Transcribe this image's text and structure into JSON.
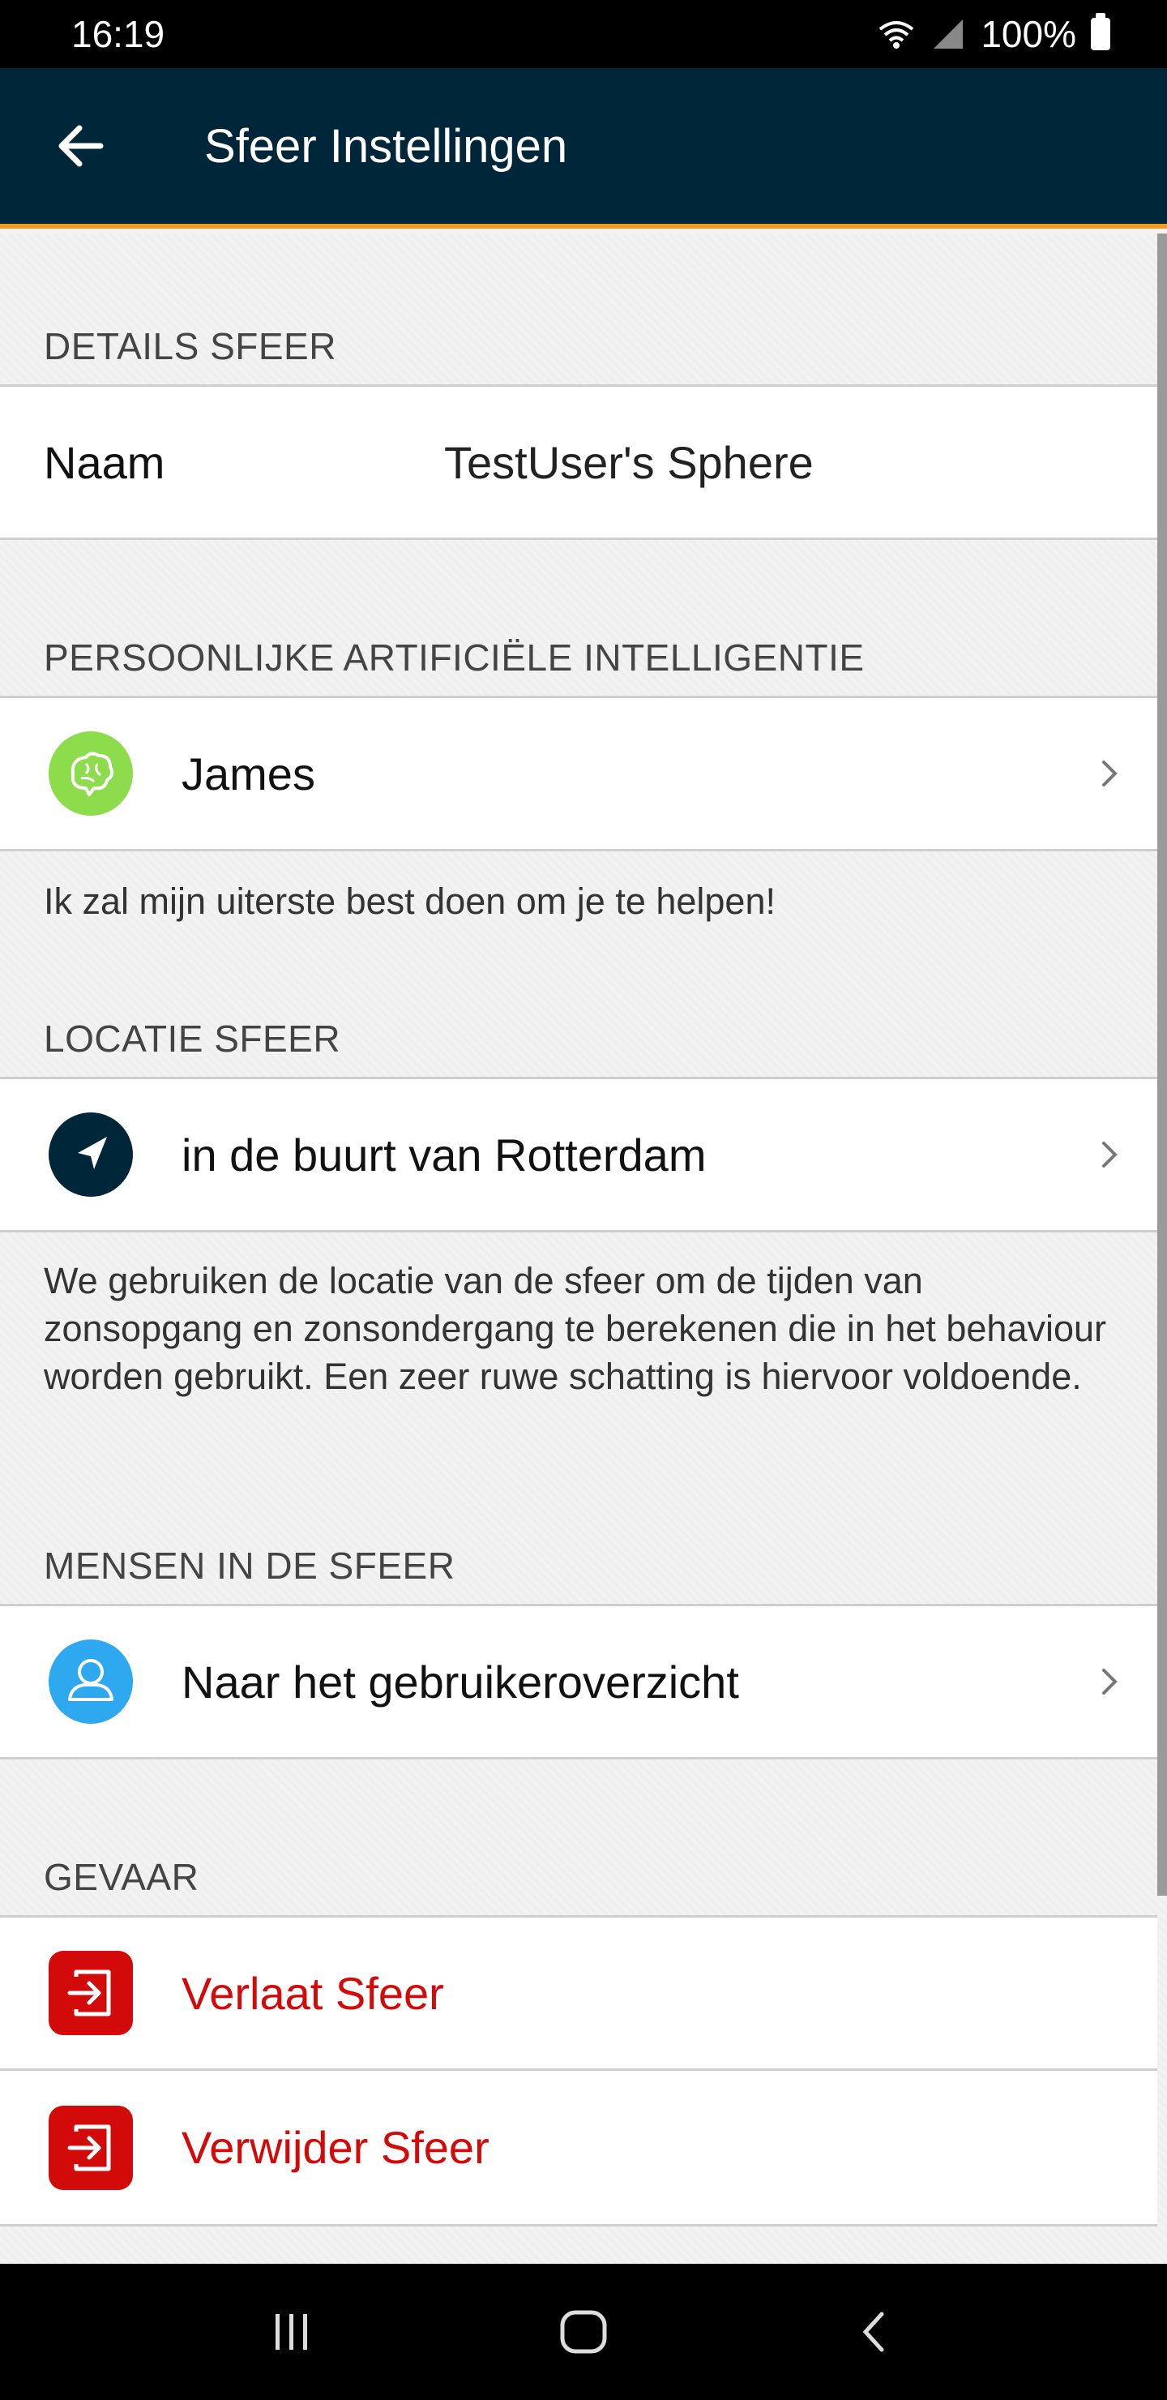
{
  "status_bar": {
    "time": "16:19",
    "battery": "100%"
  },
  "app_bar": {
    "title": "Sfeer Instellingen"
  },
  "sections": {
    "details": {
      "header": "DETAILS SFEER",
      "name_label": "Naam",
      "name_value": "TestUser's Sphere"
    },
    "ai": {
      "header": "PERSOONLIJKE ARTIFICIËLE INTELLIGENTIE",
      "name": "James",
      "description": "Ik zal mijn uiterste best doen om je te helpen!"
    },
    "location": {
      "header": "LOCATIE SFEER",
      "label": "in de buurt van Rotterdam",
      "description": "We gebruiken de locatie van de sfeer om de tijden van zonsopgang en zonsondergang te berekenen die in het behaviour worden gebruikt. Een zeer ruwe schatting is hiervoor voldoende."
    },
    "people": {
      "header": "MENSEN IN DE SFEER",
      "label": "Naar het gebruikeroverzicht"
    },
    "danger": {
      "header": "GEVAAR",
      "leave_label": "Verlaat Sfeer",
      "delete_label": "Verwijder Sfeer"
    }
  },
  "colors": {
    "app_bar": "#00263a",
    "accent": "#f29a1e",
    "ai_icon": "#8cdc4b",
    "location_icon": "#00263a",
    "people_icon": "#2ea8ee",
    "danger": "#d20a0a"
  },
  "icons": {
    "back": "arrow-left-icon",
    "ai": "brain-icon",
    "location": "navigation-arrow-icon",
    "people": "user-icon",
    "leave": "exit-icon",
    "delete": "exit-icon",
    "chevron": "chevron-right-icon"
  }
}
